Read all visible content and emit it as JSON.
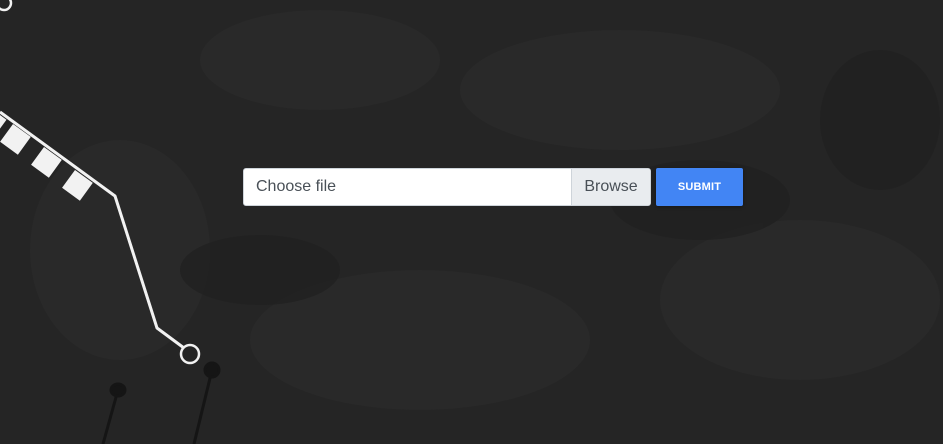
{
  "upload_form": {
    "file_input": {
      "label": "Choose file",
      "browse_label": "Browse"
    },
    "submit_label": "SUBMIT"
  },
  "theme": {
    "background": "#252525",
    "submit_color": "#4285f4",
    "line_color": "#f2f2f2"
  }
}
